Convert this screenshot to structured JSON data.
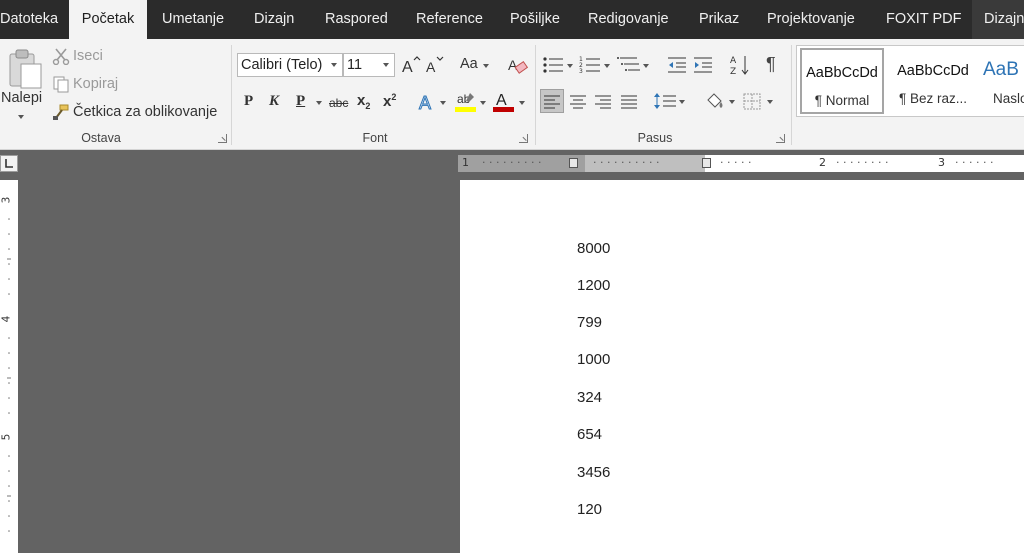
{
  "tabs": [
    "Datoteka",
    "Početak",
    "Umetanje",
    "Dizajn",
    "Raspored",
    "Reference",
    "Pošiljke",
    "Redigovanje",
    "Prikaz",
    "Projektovanje",
    "FOXIT PDF",
    "Dizajn"
  ],
  "active_tab": "Početak",
  "clipboard": {
    "paste_label": "Nalepi",
    "cut_label": "Iseci",
    "copy_label": "Kopiraj",
    "format_painter_label": "Četkica za oblikovanje",
    "group_label": "Ostava"
  },
  "font": {
    "font_name": "Calibri (Telo)",
    "font_size": "11",
    "change_case_label": "Aa",
    "bold_label": "P",
    "italic_label": "K",
    "underline_label": "P",
    "strike_label": "abc",
    "subscript_label": "x",
    "superscript_label": "x",
    "subscript_small": "2",
    "superscript_small": "2",
    "group_label": "Font"
  },
  "paragraph": {
    "group_label": "Pasus"
  },
  "styles": {
    "items": [
      {
        "sample": "AaBbCcDd",
        "name": "¶ Normal"
      },
      {
        "sample": "AaBbCcDd",
        "name": "¶ Bez raz..."
      },
      {
        "sample": "AaB",
        "name": "Naslo"
      }
    ]
  },
  "ruler": {
    "h_numbers": [
      "1",
      "1",
      "2",
      "3"
    ],
    "v_numbers": [
      "3",
      "4",
      "5"
    ]
  },
  "document": {
    "lines": [
      "8000",
      "1200",
      "799",
      "1000",
      "324",
      "654",
      "3456",
      "120"
    ]
  },
  "colors": {
    "tabbar_bg": "#2b2b2b",
    "ribbon_bg": "#f3f3f3",
    "workspace_bg": "#636363",
    "highlight_color": "#ffff00",
    "font_color": "#c00000"
  }
}
